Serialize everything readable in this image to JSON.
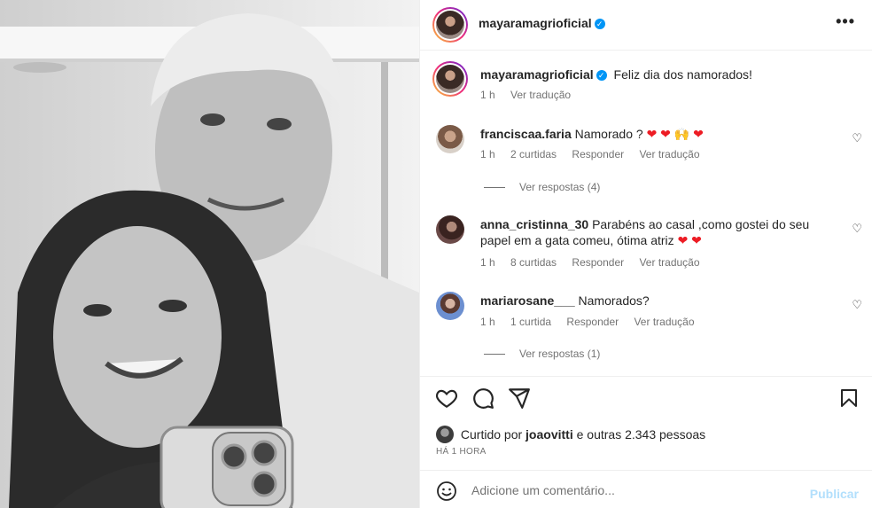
{
  "post": {
    "username": "mayaramagrioficial",
    "caption": "Feliz dia dos namorados!",
    "caption_time": "1 h",
    "translate": "Ver tradução"
  },
  "comments": [
    {
      "username": "franciscaa.faria",
      "text": "Namorado ?",
      "emojis": "❤ ❤ 🙌 ❤",
      "time": "1 h",
      "likes": "2 curtidas",
      "reply": "Responder",
      "translate": "Ver tradução",
      "view_replies": "Ver respostas (4)"
    },
    {
      "username": "anna_cristinna_30",
      "text": "Parabéns ao casal ,como gostei do seu",
      "text2": "papel em a gata comeu, ótima atriz",
      "emojis": "❤ ❤",
      "time": "1 h",
      "likes": "8 curtidas",
      "reply": "Responder",
      "translate": "Ver tradução"
    },
    {
      "username": "mariarosane___",
      "text": "Namorados?",
      "time": "1 h",
      "likes": "1 curtida",
      "reply": "Responder",
      "translate": "Ver tradução",
      "view_replies": "Ver respostas (1)"
    }
  ],
  "likes": {
    "prefix": "Curtido por",
    "user": "joaovitti",
    "suffix": "e outras 2.343 pessoas"
  },
  "timestamp": "HÁ 1 HORA",
  "add_comment": {
    "placeholder": "Adicione um comentário...",
    "publish": "Publicar"
  },
  "icons": {
    "like": "heart-icon",
    "comment": "comment-icon",
    "share": "share-icon",
    "save": "bookmark-icon",
    "more": "more-icon",
    "emoji": "emoji-icon"
  },
  "colors": {
    "verified": "#0095f6",
    "publish_disabled": "#b2dffc",
    "heart_emoji": "#ed1c24"
  }
}
